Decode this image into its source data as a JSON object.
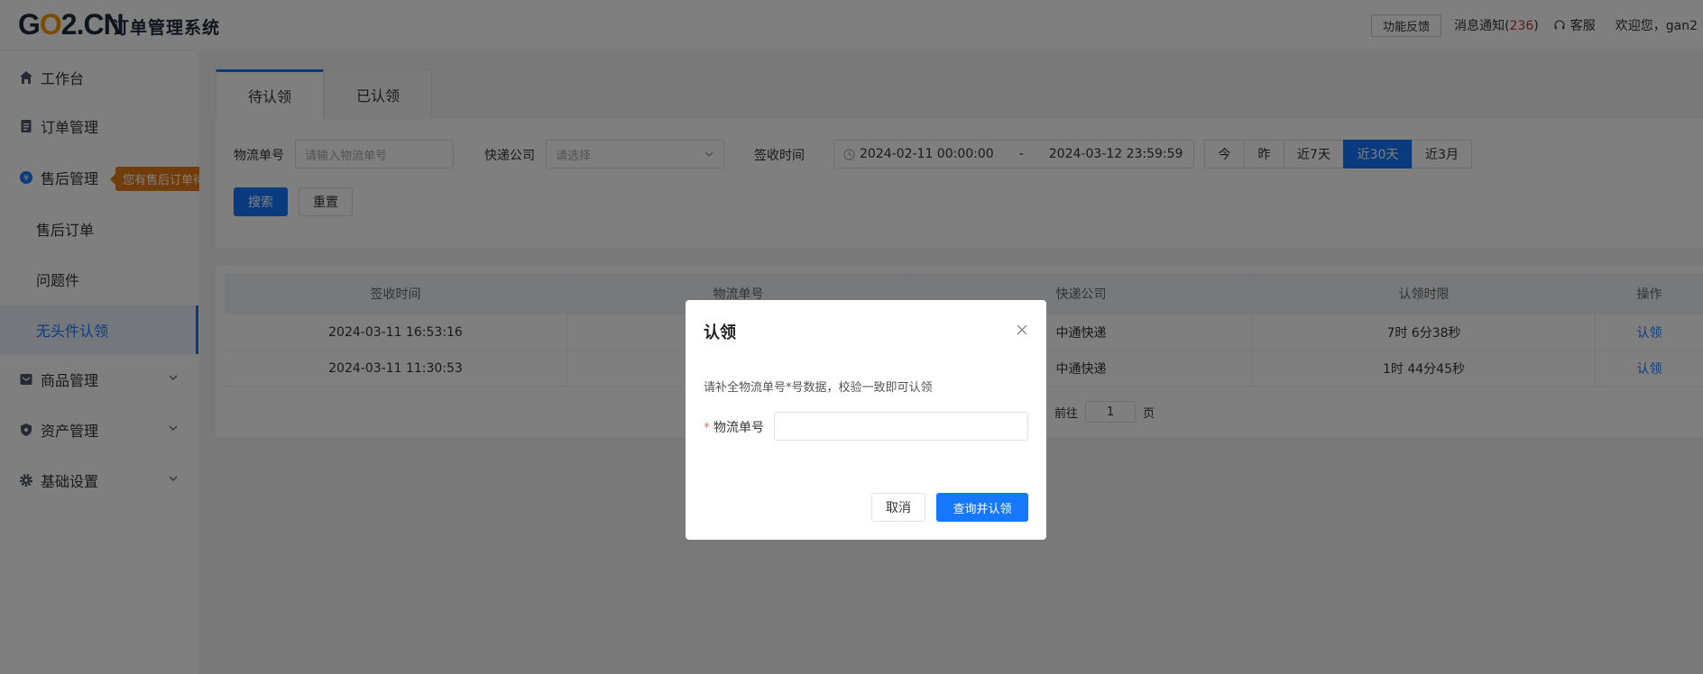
{
  "header": {
    "logo_prefix": "G",
    "logo_o": "O",
    "logo_rest": "2.CN",
    "system_title": "订单管理系统",
    "feedback_label": "功能反馈",
    "notice_label": "消息通知(",
    "notice_count": "236",
    "notice_close": ")",
    "service_label": "客服",
    "welcome": "欢迎您，gan2"
  },
  "sidebar": {
    "workbench": "工作台",
    "order_mgmt": "订单管理",
    "order_tooltip": "您有售后订单待处理",
    "aftersale_mgmt": "售后管理",
    "aftersale_orders": "售后订单",
    "problem_items": "问题件",
    "headless_claim": "无头件认领",
    "goods_mgmt": "商品管理",
    "asset_mgmt": "资产管理",
    "base_settings": "基础设置"
  },
  "tabs": {
    "pending": "待认领",
    "claimed": "已认领"
  },
  "filters": {
    "tracking_label": "物流单号",
    "tracking_placeholder": "请输入物流单号",
    "courier_label": "快递公司",
    "courier_placeholder": "请选择",
    "sign_time_label": "签收时间",
    "date_start": "2024-02-11 00:00:00",
    "date_sep": "-",
    "date_end": "2024-03-12 23:59:59",
    "quick": [
      "今",
      "昨",
      "近7天",
      "近30天",
      "近3月"
    ],
    "quick_selected": "近30天",
    "search_btn": "搜索",
    "reset_btn": "重置"
  },
  "table": {
    "columns": [
      "签收时间",
      "物流单号",
      "快递公司",
      "认领时限",
      "操作"
    ],
    "rows": [
      {
        "sign_time": "2024-03-11 16:53:16",
        "tracking": "",
        "courier": "中通快递",
        "deadline": "7时 6分38秒",
        "action": "认领"
      },
      {
        "sign_time": "2024-03-11 11:30:53",
        "tracking": "",
        "courier": "中通快递",
        "deadline": "1时 44分45秒",
        "action": "认领"
      }
    ],
    "pager_goto": "前往",
    "pager_page": "1",
    "pager_unit": "页"
  },
  "modal": {
    "title": "认领",
    "description": "请补全物流单号*号数据，校验一致即可认领",
    "field_required": "*",
    "field_label": "物流单号",
    "field_value": "",
    "cancel_btn": "取消",
    "ok_btn": "查询并认领"
  },
  "colors": {
    "primary": "#1677ff",
    "logo_accent": "#f39800",
    "tooltip": "#e27a1b",
    "notice_count": "#c0392b"
  }
}
